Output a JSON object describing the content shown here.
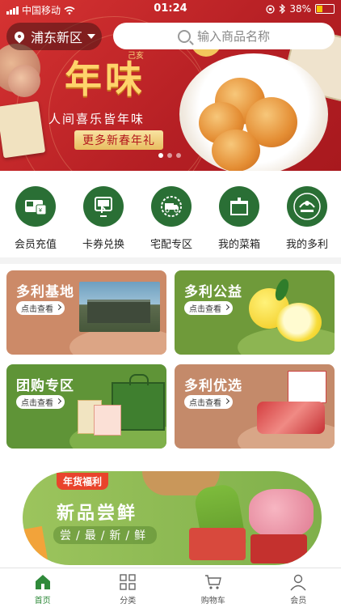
{
  "status_bar": {
    "carrier": "中国移动",
    "time": "01:24",
    "battery": "38%",
    "battery_level": 0.38
  },
  "header": {
    "location": "浦东新区",
    "search_placeholder": "输入商品名称"
  },
  "banner": {
    "headline": "年味",
    "small_tag": "己亥",
    "slogan": "人间喜乐皆年味",
    "cta": "更多新春年礼",
    "slide_count": 3,
    "active_slide": 1
  },
  "quick_menu": [
    {
      "label": "会员充值",
      "icon": "card-recharge-icon"
    },
    {
      "label": "卡券兑换",
      "icon": "voucher-exchange-icon"
    },
    {
      "label": "宅配专区",
      "icon": "delivery-truck-icon"
    },
    {
      "label": "我的菜箱",
      "icon": "vegetable-box-icon"
    },
    {
      "label": "我的多利",
      "icon": "farm-logo-icon"
    }
  ],
  "cards": [
    {
      "title": "多利基地",
      "button": "点击查看",
      "color": "#cc8a68"
    },
    {
      "title": "多利公益",
      "button": "点击查看",
      "color": "#6f9a3a"
    },
    {
      "title": "团购专区",
      "button": "点击查看",
      "color": "#5f9437"
    },
    {
      "title": "多利优选",
      "button": "点击查看",
      "color": "#c48a6a"
    }
  ],
  "promo": {
    "tag": "年货福利",
    "headline": "新品尝鲜",
    "subline": "尝/最/新/鲜"
  },
  "tabbar": [
    {
      "label": "首页",
      "icon": "home-icon",
      "active": true
    },
    {
      "label": "分类",
      "icon": "grid-icon",
      "active": false
    },
    {
      "label": "购物车",
      "icon": "cart-icon",
      "active": false
    },
    {
      "label": "会员",
      "icon": "user-icon",
      "active": false
    }
  ],
  "colors": {
    "brand_green": "#2a6f35",
    "banner_red": "#c4262b",
    "active_tab": "#2f8a3a"
  }
}
